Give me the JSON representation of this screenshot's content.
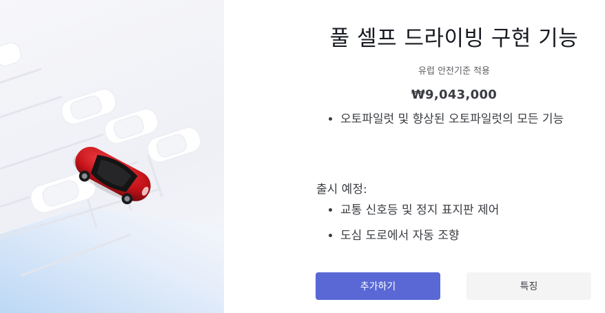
{
  "option": {
    "title": "풀 셀프 드라이빙 구현 기능",
    "subtitle": "유럽 안전기준 적용",
    "price": "₩9,043,000",
    "features": [
      "오토파일럿 및 향상된 오토파일럿의 모든 기능"
    ],
    "upcoming_label": "출시 예정:",
    "upcoming_features": [
      "교통 신호등 및 정지 표지판 제어",
      "도심 도로에서 자동 조향"
    ]
  },
  "actions": {
    "add_label": "추가하기",
    "features_label": "특징"
  },
  "colors": {
    "primary_button": "#5a68d6",
    "secondary_button": "#f4f4f4",
    "car_red": "#c8141b"
  },
  "hero": {
    "icon": "parking-lot-car-illustration"
  }
}
